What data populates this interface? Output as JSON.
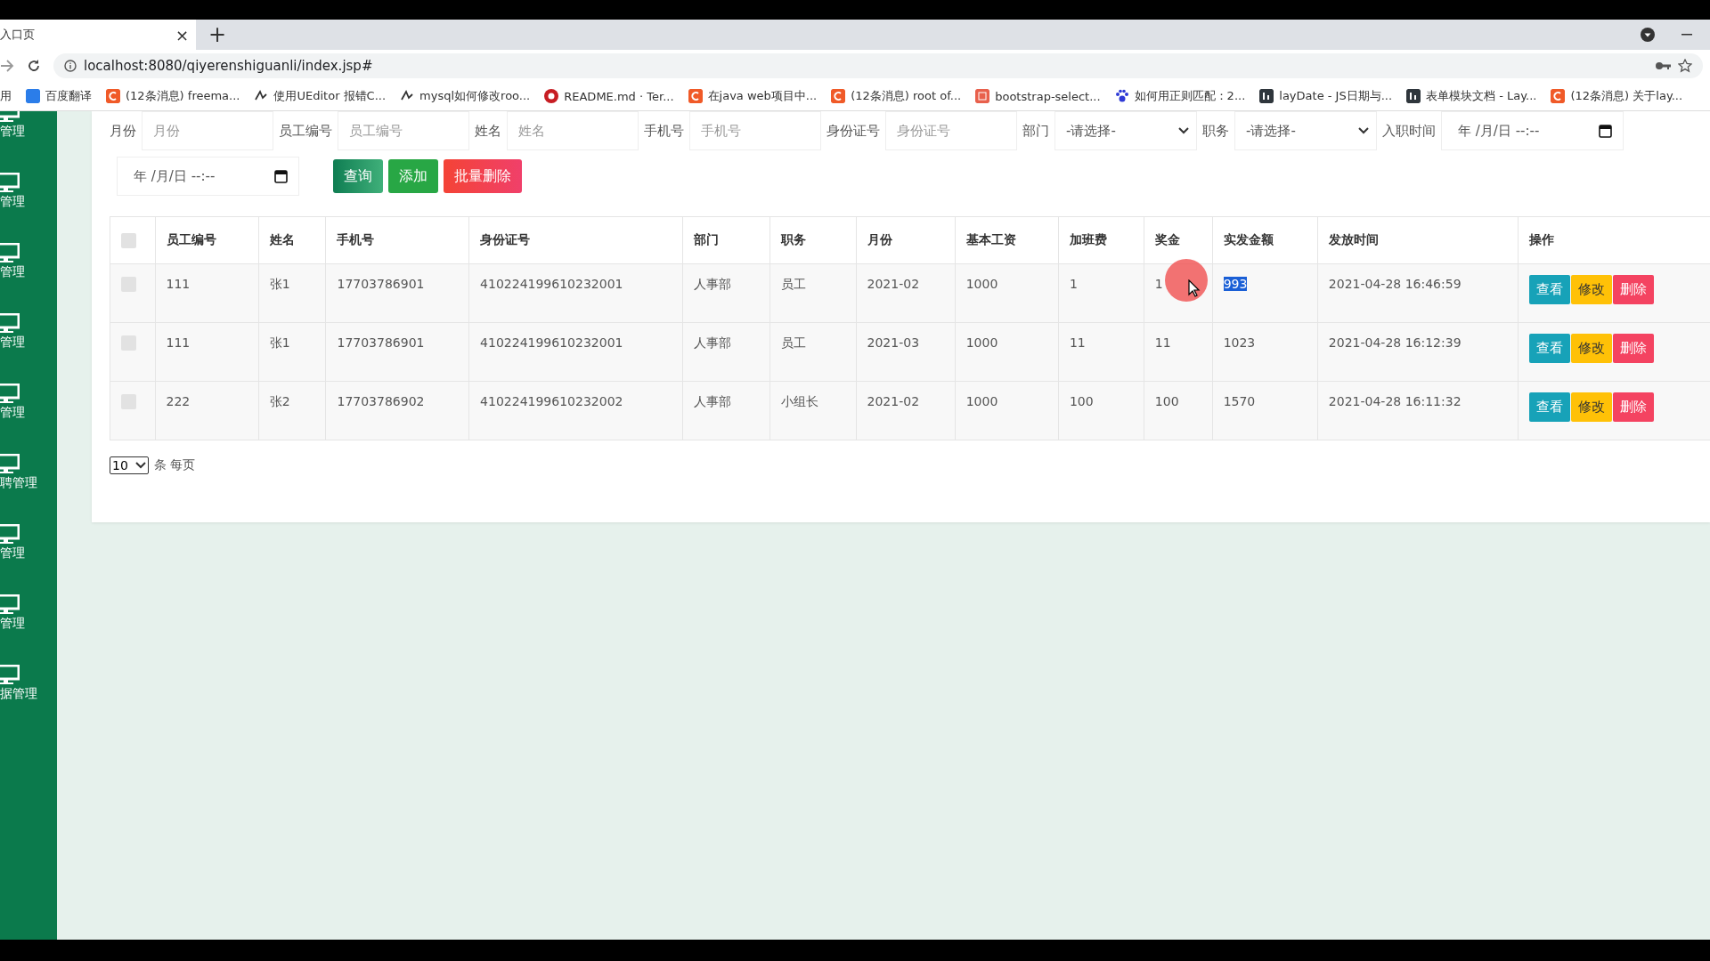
{
  "browser": {
    "tab_title": "入口页",
    "tab_close": "×",
    "new_tab": "+",
    "url": "localhost:8080/qiyerenshiguanli/index.jsp#",
    "bookmarks": [
      {
        "label": "用",
        "kind": "none"
      },
      {
        "label": "百度翻译",
        "kind": "translate"
      },
      {
        "label": "(12条消息) freema...",
        "kind": "csdn"
      },
      {
        "label": "使用UEditor 报错C...",
        "kind": "logo"
      },
      {
        "label": "mysql如何修改roo...",
        "kind": "logo"
      },
      {
        "label": "README.md · Ter...",
        "kind": "gitee"
      },
      {
        "label": "在java web项目中...",
        "kind": "csdn"
      },
      {
        "label": "(12条消息) root of...",
        "kind": "csdn"
      },
      {
        "label": "bootstrap-select...",
        "kind": "jian"
      },
      {
        "label": "如何用正则匹配：2...",
        "kind": "paw"
      },
      {
        "label": "layDate - JS日期与...",
        "kind": "layui"
      },
      {
        "label": "表单模块文档 - Lay...",
        "kind": "layui"
      },
      {
        "label": "(12条消息) 关于lay...",
        "kind": "csdn"
      }
    ]
  },
  "sidebar": {
    "items": [
      "管理",
      "管理",
      "管理",
      "管理",
      "管理",
      "聘管理",
      "管理",
      "管理",
      "据管理"
    ]
  },
  "filters": [
    {
      "label": "月份",
      "kind": "text",
      "placeholder": "月份"
    },
    {
      "label": "员工编号",
      "kind": "text",
      "placeholder": "员工编号"
    },
    {
      "label": "姓名",
      "kind": "text",
      "placeholder": "姓名"
    },
    {
      "label": "手机号",
      "kind": "text",
      "placeholder": "手机号"
    },
    {
      "label": "身份证号",
      "kind": "text",
      "placeholder": "身份证号"
    },
    {
      "label": "部门",
      "kind": "select",
      "value": "-请选择-"
    },
    {
      "label": "职务",
      "kind": "select",
      "value": "-请选择-"
    },
    {
      "label": "入职时间",
      "kind": "date",
      "value": "年 /月/日 --:--"
    }
  ],
  "second_date": "年 /月/日 --:--",
  "actions": [
    {
      "label": "查询",
      "kind": "query"
    },
    {
      "label": "添加",
      "kind": "add"
    },
    {
      "label": "批量删除",
      "kind": "delete"
    }
  ],
  "table": {
    "header_checked": false,
    "columns": [
      "员工编号",
      "姓名",
      "手机号",
      "身份证号",
      "部门",
      "职务",
      "月份",
      "基本工资",
      "加班费",
      "奖金",
      "实发金额",
      "发放时间",
      "操作"
    ],
    "rows": [
      {
        "checked": false,
        "cells": [
          {
            "text": "111",
            "selected": false
          },
          {
            "text": "张1",
            "selected": false
          },
          {
            "text": "17703786901",
            "selected": false
          },
          {
            "text": "410224199610232001",
            "selected": false
          },
          {
            "text": "人事部",
            "selected": false
          },
          {
            "text": "员工",
            "selected": false
          },
          {
            "text": "2021-02",
            "selected": false
          },
          {
            "text": "1000",
            "selected": false
          },
          {
            "text": "1",
            "selected": false
          },
          {
            "text": "1",
            "selected": false
          },
          {
            "text": "993",
            "selected": true
          },
          {
            "text": "2021-04-28 16:46:59",
            "selected": false
          }
        ],
        "buttons": [
          {
            "label": "查看",
            "kind": "view"
          },
          {
            "label": "修改",
            "kind": "edit"
          },
          {
            "label": "删除",
            "kind": "delete"
          }
        ]
      },
      {
        "checked": false,
        "cells": [
          {
            "text": "111",
            "selected": false
          },
          {
            "text": "张1",
            "selected": false
          },
          {
            "text": "17703786901",
            "selected": false
          },
          {
            "text": "410224199610232001",
            "selected": false
          },
          {
            "text": "人事部",
            "selected": false
          },
          {
            "text": "员工",
            "selected": false
          },
          {
            "text": "2021-03",
            "selected": false
          },
          {
            "text": "1000",
            "selected": false
          },
          {
            "text": "11",
            "selected": false
          },
          {
            "text": "11",
            "selected": false
          },
          {
            "text": "1023",
            "selected": false
          },
          {
            "text": "2021-04-28 16:12:39",
            "selected": false
          }
        ],
        "buttons": [
          {
            "label": "查看",
            "kind": "view"
          },
          {
            "label": "修改",
            "kind": "edit"
          },
          {
            "label": "删除",
            "kind": "delete"
          }
        ]
      },
      {
        "checked": false,
        "cells": [
          {
            "text": "222",
            "selected": false
          },
          {
            "text": "张2",
            "selected": false
          },
          {
            "text": "17703786902",
            "selected": false
          },
          {
            "text": "410224199610232002",
            "selected": false
          },
          {
            "text": "人事部",
            "selected": false
          },
          {
            "text": "小组长",
            "selected": false
          },
          {
            "text": "2021-02",
            "selected": false
          },
          {
            "text": "1000",
            "selected": false
          },
          {
            "text": "100",
            "selected": false
          },
          {
            "text": "100",
            "selected": false
          },
          {
            "text": "1570",
            "selected": false
          },
          {
            "text": "2021-04-28 16:11:32",
            "selected": false
          }
        ],
        "buttons": [
          {
            "label": "查看",
            "kind": "view"
          },
          {
            "label": "修改",
            "kind": "edit"
          },
          {
            "label": "删除",
            "kind": "delete"
          }
        ]
      }
    ]
  },
  "page_size": {
    "value": "10",
    "suffix": "条 每页"
  }
}
